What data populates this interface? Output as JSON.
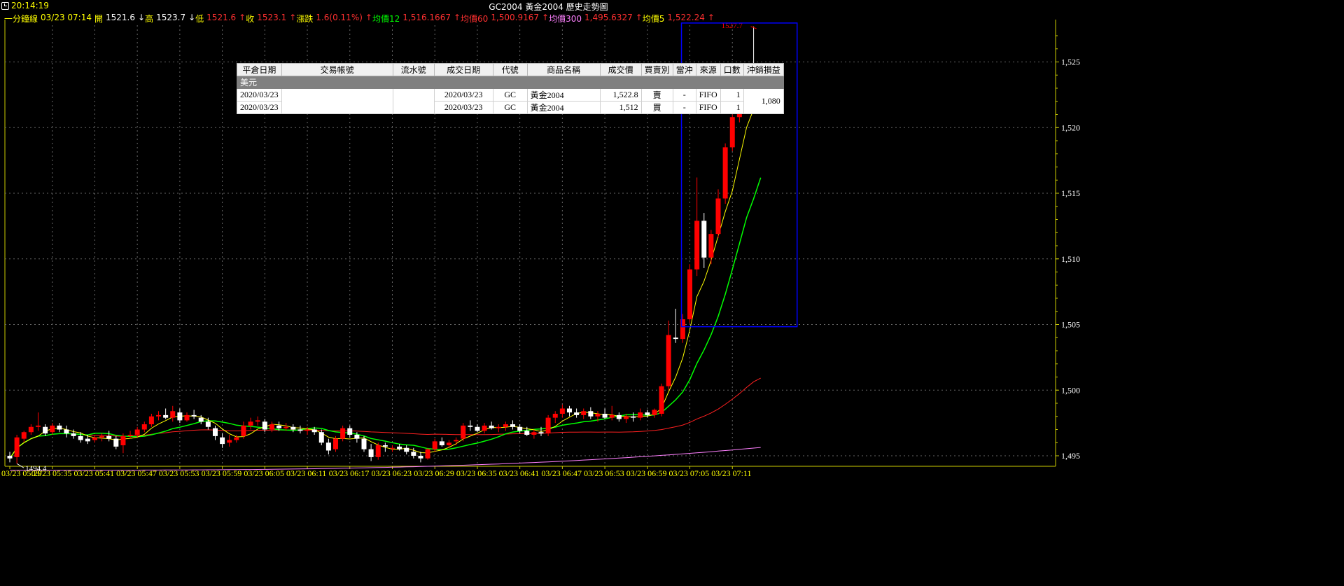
{
  "header": {
    "clock": "20:14:19",
    "title": "GC2004 黃金2004  歷史走勢圖",
    "icon": "clock-icon"
  },
  "info_bar": {
    "period_label": "一分鐘線",
    "datetime": "03/23 07:14",
    "open_label": "開",
    "open_value": "1521.6",
    "high_arrow": "↓",
    "high_label": "高",
    "high_value": "1523.7",
    "low_arrow": "↓",
    "low_label": "低",
    "low_value": "1521.6",
    "close_arrow": "↑",
    "close_label": "收",
    "close_value": "1523.1",
    "change_arrow": "↑",
    "change_label": "漲跌",
    "change_value": "1.6(0.11%)",
    "ma12_arrow": "↑",
    "ma12_label": "均價12",
    "ma12_value": "1,516.1667",
    "ma60_arrow": "↑",
    "ma60_label": "均價60",
    "ma60_value": "1,500.9167",
    "ma300_arrow": "↑",
    "ma300_label": "均價300",
    "ma300_value": "1,495.6327",
    "ma5_arrow": "↑",
    "ma5_label": "均價5",
    "ma5_value": "1,522.24",
    "end_arrow": "↑"
  },
  "trade_table": {
    "headers": [
      "平倉日期",
      "交易帳號",
      "流水號",
      "成交日期",
      "代號",
      "商品名稱",
      "成交價",
      "買賣別",
      "當沖",
      "來源",
      "口數",
      "沖銷損益"
    ],
    "group_label": "美元",
    "account_blur": "",
    "serial_blur": "",
    "rows": [
      {
        "close_date": "2020/03/23",
        "trade_date": "2020/03/23",
        "code": "GC",
        "name": "黃金2004",
        "price": "1,522.8",
        "side": "賣",
        "daytrade": "-",
        "source": "FIFO",
        "qty": "1"
      },
      {
        "close_date": "2020/03/23",
        "trade_date": "2020/03/23",
        "code": "GC",
        "name": "黃金2004",
        "price": "1,512",
        "side": "買",
        "daytrade": "-",
        "source": "FIFO",
        "qty": "1"
      }
    ],
    "pnl": "1,080"
  },
  "colors": {
    "up": "#ff0000",
    "down": "#ffffff",
    "ma5": "#ffff00",
    "ma12": "#00ff00",
    "ma60": "#ff2020",
    "ma300": "#ff80ff",
    "axis": "#cccc00",
    "grid": "#666666",
    "highlight_box": "#0000ff"
  },
  "chart_data": {
    "type": "candlestick",
    "title": "GC2004 黃金2004  歷史走勢圖",
    "y_ticks": [
      "1,495",
      "1,500",
      "1,505",
      "1,510",
      "1,515",
      "1,520",
      "1,525"
    ],
    "ylim": [
      1494.2,
      1527.8
    ],
    "x_ticks": [
      "03/23 05:29",
      "03/23 05:35",
      "03/23 05:41",
      "03/23 05:47",
      "03/23 05:53",
      "03/23 05:59",
      "03/23 06:05",
      "03/23 06:11",
      "03/23 06:17",
      "03/23 06:23",
      "03/23 06:29",
      "03/23 06:35",
      "03/23 06:41",
      "03/23 06:47",
      "03/23 06:53",
      "03/23 06:59",
      "03/23 07:05",
      "03/23 07:11"
    ],
    "high_label": "1527.7",
    "low_label": "1494.4",
    "grid": true,
    "candles": [
      [
        1495.0,
        1495.3,
        1494.5,
        1494.8
      ],
      [
        1494.9,
        1496.6,
        1494.4,
        1496.4
      ],
      [
        1496.3,
        1496.9,
        1496.0,
        1496.8
      ],
      [
        1496.8,
        1497.4,
        1496.6,
        1497.2
      ],
      [
        1497.2,
        1498.3,
        1496.9,
        1497.3
      ],
      [
        1497.2,
        1497.4,
        1496.5,
        1496.7
      ],
      [
        1496.8,
        1497.5,
        1496.6,
        1497.3
      ],
      [
        1497.3,
        1497.5,
        1496.8,
        1497.0
      ],
      [
        1497.0,
        1497.3,
        1496.4,
        1496.7
      ],
      [
        1496.7,
        1497.0,
        1496.3,
        1496.5
      ],
      [
        1496.5,
        1496.8,
        1496.0,
        1496.2
      ],
      [
        1496.3,
        1496.6,
        1495.9,
        1496.1
      ],
      [
        1496.2,
        1496.6,
        1496.0,
        1496.4
      ],
      [
        1496.4,
        1496.7,
        1496.1,
        1496.5
      ],
      [
        1496.5,
        1496.9,
        1496.1,
        1496.3
      ],
      [
        1496.3,
        1496.5,
        1495.5,
        1495.7
      ],
      [
        1495.8,
        1496.7,
        1495.2,
        1496.5
      ],
      [
        1496.5,
        1496.9,
        1496.3,
        1496.6
      ],
      [
        1496.6,
        1497.2,
        1496.4,
        1497.0
      ],
      [
        1497.0,
        1497.6,
        1496.8,
        1497.4
      ],
      [
        1497.4,
        1498.2,
        1497.2,
        1498.0
      ],
      [
        1498.0,
        1498.4,
        1497.7,
        1498.1
      ],
      [
        1498.1,
        1498.6,
        1497.8,
        1497.9
      ],
      [
        1497.9,
        1498.8,
        1497.6,
        1498.4
      ],
      [
        1498.3,
        1498.6,
        1497.5,
        1497.7
      ],
      [
        1497.7,
        1498.3,
        1497.6,
        1498.1
      ],
      [
        1498.1,
        1498.5,
        1497.8,
        1498.0
      ],
      [
        1497.9,
        1498.1,
        1497.4,
        1497.6
      ],
      [
        1497.6,
        1497.9,
        1497.0,
        1497.2
      ],
      [
        1497.1,
        1497.3,
        1496.2,
        1496.5
      ],
      [
        1496.4,
        1496.7,
        1495.6,
        1495.9
      ],
      [
        1496.0,
        1496.6,
        1495.7,
        1496.2
      ],
      [
        1496.2,
        1496.6,
        1496.0,
        1496.4
      ],
      [
        1496.5,
        1497.6,
        1496.3,
        1497.3
      ],
      [
        1497.3,
        1497.9,
        1497.0,
        1497.6
      ],
      [
        1497.6,
        1498.0,
        1497.3,
        1497.7
      ],
      [
        1497.6,
        1497.8,
        1496.8,
        1497.0
      ],
      [
        1497.0,
        1497.6,
        1496.8,
        1497.4
      ],
      [
        1497.3,
        1497.6,
        1496.9,
        1497.1
      ],
      [
        1497.1,
        1497.5,
        1496.9,
        1497.2
      ],
      [
        1497.2,
        1497.4,
        1496.8,
        1497.0
      ],
      [
        1497.0,
        1497.3,
        1496.7,
        1496.9
      ],
      [
        1496.9,
        1497.2,
        1496.6,
        1497.0
      ],
      [
        1497.0,
        1497.2,
        1496.6,
        1496.8
      ],
      [
        1496.8,
        1497.0,
        1495.8,
        1496.0
      ],
      [
        1496.0,
        1496.3,
        1495.1,
        1495.4
      ],
      [
        1495.5,
        1496.5,
        1495.3,
        1496.3
      ],
      [
        1496.3,
        1497.3,
        1496.1,
        1497.1
      ],
      [
        1497.1,
        1497.3,
        1496.4,
        1496.6
      ],
      [
        1496.6,
        1496.8,
        1496.0,
        1496.3
      ],
      [
        1496.3,
        1496.5,
        1495.3,
        1495.5
      ],
      [
        1495.5,
        1495.9,
        1494.6,
        1494.9
      ],
      [
        1494.9,
        1496.0,
        1494.7,
        1495.8
      ],
      [
        1495.8,
        1496.0,
        1495.3,
        1495.7
      ],
      [
        1495.6,
        1495.8,
        1495.3,
        1495.6
      ],
      [
        1495.7,
        1495.9,
        1495.4,
        1495.5
      ],
      [
        1495.6,
        1495.8,
        1495.1,
        1495.3
      ],
      [
        1495.3,
        1495.6,
        1494.8,
        1495.0
      ],
      [
        1495.0,
        1495.3,
        1494.5,
        1494.8
      ],
      [
        1494.8,
        1495.6,
        1494.7,
        1495.5
      ],
      [
        1495.5,
        1496.3,
        1495.3,
        1496.1
      ],
      [
        1496.1,
        1496.4,
        1495.7,
        1495.8
      ],
      [
        1495.8,
        1496.2,
        1495.6,
        1496.0
      ],
      [
        1496.1,
        1496.4,
        1495.8,
        1496.2
      ],
      [
        1496.3,
        1497.5,
        1496.1,
        1497.3
      ],
      [
        1497.3,
        1497.7,
        1496.9,
        1497.2
      ],
      [
        1497.2,
        1497.4,
        1496.8,
        1496.9
      ],
      [
        1496.9,
        1497.5,
        1496.7,
        1497.3
      ],
      [
        1497.3,
        1497.6,
        1497.0,
        1497.1
      ],
      [
        1497.1,
        1497.4,
        1496.8,
        1497.2
      ],
      [
        1497.2,
        1497.6,
        1496.9,
        1497.4
      ],
      [
        1497.4,
        1497.7,
        1497.0,
        1497.2
      ],
      [
        1497.2,
        1497.4,
        1496.7,
        1496.9
      ],
      [
        1496.9,
        1497.2,
        1496.5,
        1496.6
      ],
      [
        1496.6,
        1497.0,
        1496.3,
        1496.8
      ],
      [
        1496.8,
        1497.2,
        1496.5,
        1496.7
      ],
      [
        1496.7,
        1498.1,
        1496.5,
        1497.9
      ],
      [
        1497.9,
        1498.4,
        1497.5,
        1498.2
      ],
      [
        1498.2,
        1498.9,
        1497.9,
        1498.6
      ],
      [
        1498.6,
        1498.8,
        1498.0,
        1498.3
      ],
      [
        1498.3,
        1498.6,
        1497.9,
        1498.1
      ],
      [
        1498.1,
        1498.6,
        1497.8,
        1498.4
      ],
      [
        1498.4,
        1498.7,
        1497.8,
        1498.0
      ],
      [
        1498.0,
        1498.4,
        1497.6,
        1498.2
      ],
      [
        1498.2,
        1498.6,
        1497.8,
        1497.9
      ],
      [
        1497.9,
        1498.8,
        1497.7,
        1498.1
      ],
      [
        1498.1,
        1498.3,
        1497.6,
        1497.8
      ],
      [
        1497.8,
        1498.2,
        1497.5,
        1498.0
      ],
      [
        1498.0,
        1498.3,
        1497.6,
        1497.9
      ],
      [
        1497.9,
        1498.6,
        1497.7,
        1498.3
      ],
      [
        1498.3,
        1498.5,
        1497.9,
        1498.1
      ],
      [
        1498.1,
        1498.6,
        1497.9,
        1498.5
      ],
      [
        1498.2,
        1500.5,
        1498.0,
        1500.3
      ],
      [
        1500.3,
        1505.3,
        1500.0,
        1504.2
      ],
      [
        1504.0,
        1506.2,
        1503.6,
        1503.9
      ],
      [
        1503.9,
        1505.8,
        1503.6,
        1505.4
      ],
      [
        1505.4,
        1509.6,
        1505.1,
        1509.2
      ],
      [
        1509.2,
        1516.2,
        1508.7,
        1512.9
      ],
      [
        1512.9,
        1513.5,
        1509.3,
        1510.1
      ],
      [
        1510.1,
        1512.2,
        1509.6,
        1511.9
      ],
      [
        1511.9,
        1515.3,
        1511.6,
        1514.6
      ],
      [
        1514.6,
        1518.8,
        1514.2,
        1518.5
      ],
      [
        1518.5,
        1521.0,
        1518.2,
        1520.8
      ],
      [
        1520.8,
        1522.6,
        1520.4,
        1522.2
      ],
      [
        1522.2,
        1524.6,
        1521.4,
        1523.9
      ],
      [
        1523.9,
        1527.7,
        1521.2,
        1521.6
      ],
      [
        1521.6,
        1523.7,
        1521.6,
        1523.1
      ]
    ],
    "box_from_index": 96,
    "ma5": [],
    "ma12": [],
    "ma60_end": 1500.9167,
    "ma300_end": 1495.6327
  }
}
